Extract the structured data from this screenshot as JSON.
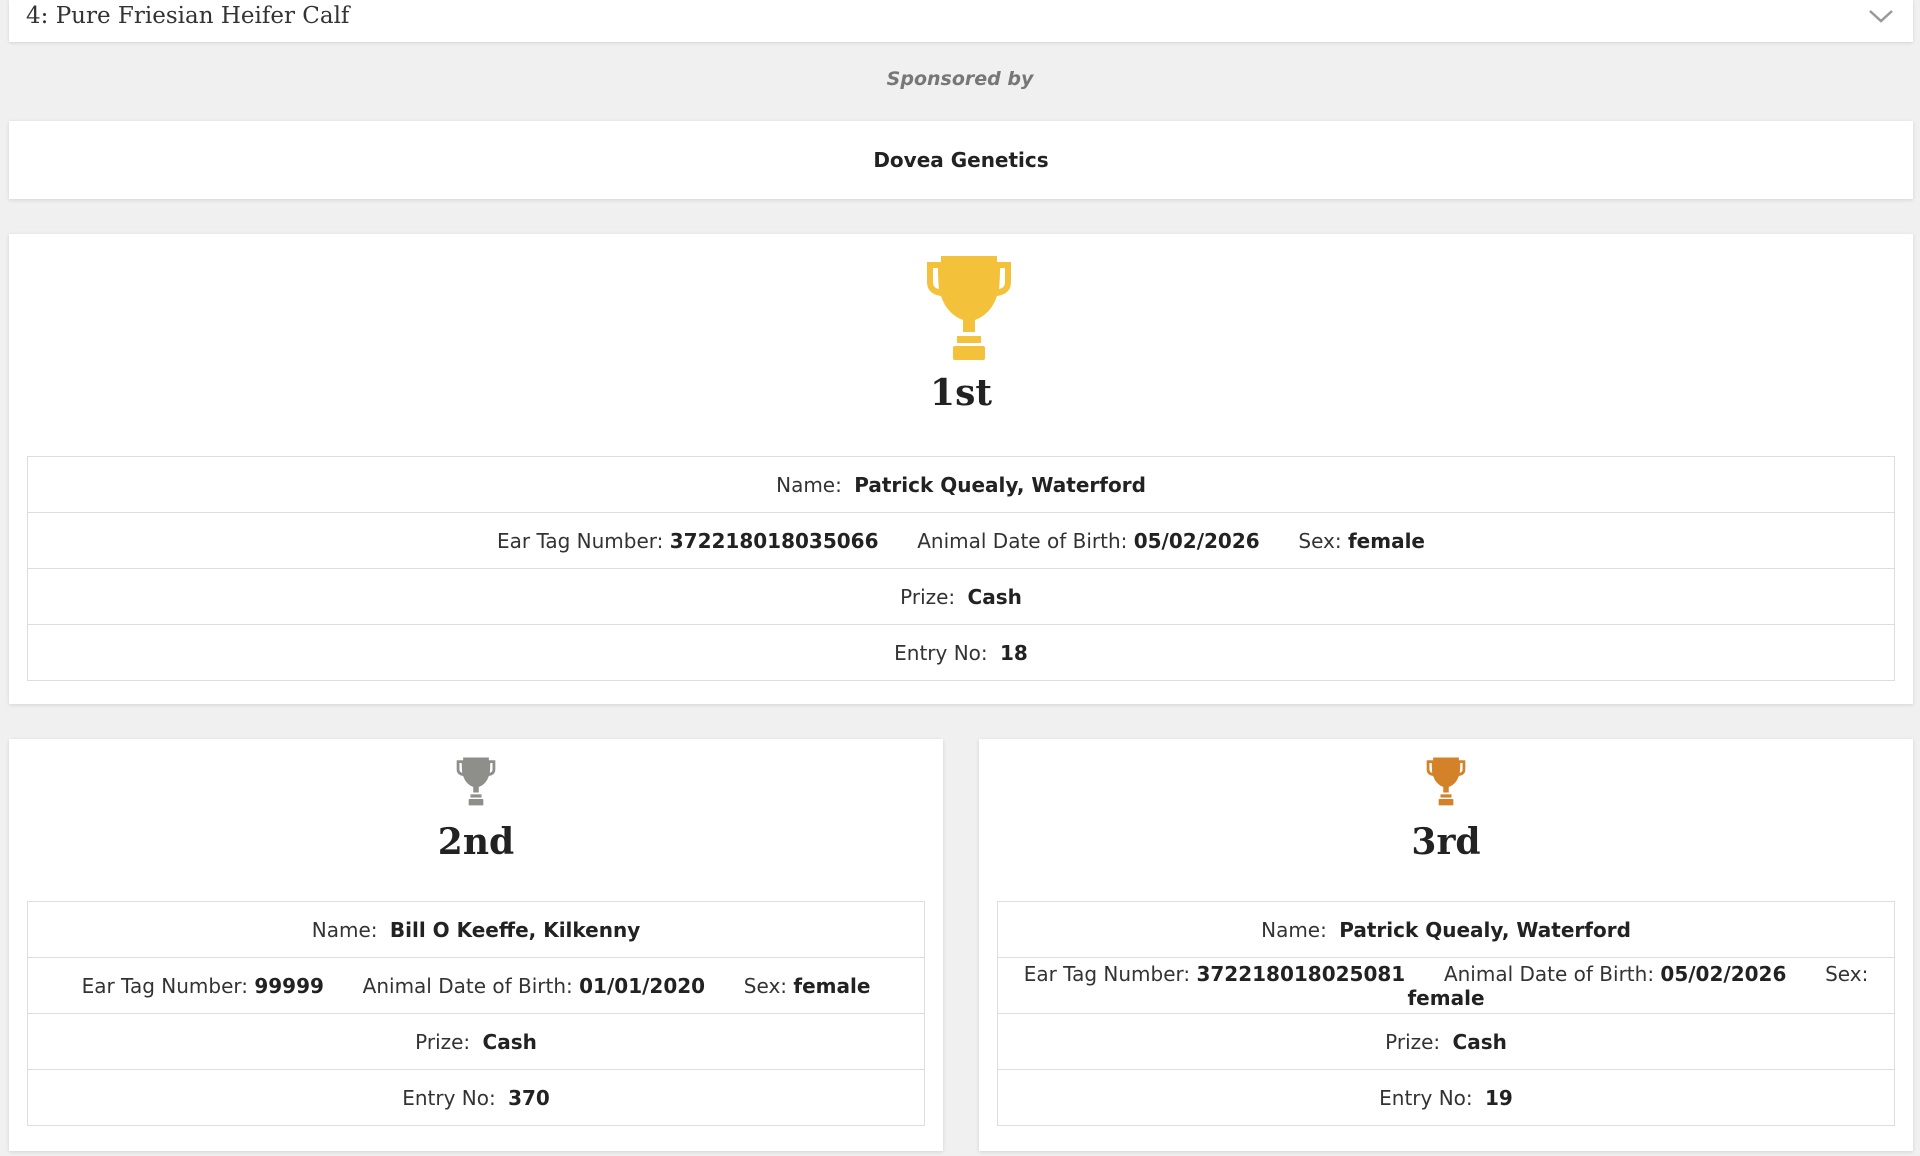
{
  "accordion": {
    "title": "4: Pure Friesian Heifer Calf"
  },
  "sponsor": {
    "label": "Sponsored by",
    "name": "Dovea Genetics"
  },
  "labels": {
    "name": "Name:",
    "ear_tag": "Ear Tag Number:",
    "dob": "Animal Date of Birth:",
    "sex": "Sex:",
    "prize": "Prize:",
    "entry": "Entry No:"
  },
  "colors": {
    "gold": "#F3C13A",
    "silver": "#8E8E8A",
    "bronze": "#D4822A"
  },
  "placings": [
    {
      "place": "1st",
      "trophy_icon": "trophy-icon",
      "name": "Patrick Quealy, Waterford",
      "ear_tag": "372218018035066",
      "dob": "05/02/2026",
      "sex": "female",
      "prize": "Cash",
      "entry_no": "18"
    },
    {
      "place": "2nd",
      "trophy_icon": "trophy-icon",
      "name": "Bill O Keeffe, Kilkenny",
      "ear_tag": "99999",
      "dob": "01/01/2020",
      "sex": "female",
      "prize": "Cash",
      "entry_no": "370"
    },
    {
      "place": "3rd",
      "trophy_icon": "trophy-icon",
      "name": "Patrick Quealy, Waterford",
      "ear_tag": "372218018025081",
      "dob": "05/02/2026",
      "sex": "female",
      "prize": "Cash",
      "entry_no": "19"
    }
  ]
}
